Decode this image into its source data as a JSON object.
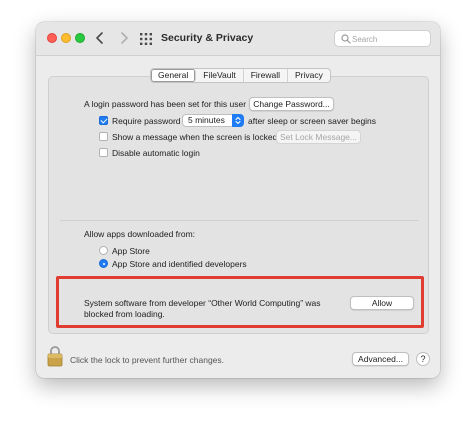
{
  "titlebar": {
    "title": "Security & Privacy",
    "search_placeholder": "Search",
    "icons": [
      "back-chevron-icon",
      "forward-chevron-icon",
      "show-all-grid-icon",
      "search-icon"
    ]
  },
  "tabs": [
    {
      "label": "General",
      "active": true
    },
    {
      "label": "FileVault",
      "active": false
    },
    {
      "label": "Firewall",
      "active": false
    },
    {
      "label": "Privacy",
      "active": false
    }
  ],
  "general": {
    "login_password_text": "A login password has been set for this user",
    "change_password_button": "Change Password...",
    "require_password": {
      "label": "Require password",
      "checked": true,
      "select_value": "5 minutes",
      "suffix": "after sleep or screen saver begins"
    },
    "show_message": {
      "label": "Show a message when the screen is locked",
      "checked": false,
      "button": "Set Lock Message..."
    },
    "disable_auto_login": {
      "label": "Disable automatic login",
      "checked": false
    }
  },
  "allow_apps": {
    "heading": "Allow apps downloaded from:",
    "options": [
      {
        "label": "App Store",
        "selected": false
      },
      {
        "label": "App Store and identified developers",
        "selected": true
      }
    ]
  },
  "blocked": {
    "line1": "System software from developer “Other World Computing” was",
    "line2": "blocked from loading.",
    "allow_button": "Allow"
  },
  "footer": {
    "lock_text": "Click the lock to prevent further changes.",
    "advanced_button": "Advanced...",
    "help_button": "?"
  },
  "colors": {
    "accent": "#1f7cf5",
    "highlight_box": "#e03c31",
    "traffic_close": "#ff5f57",
    "traffic_minimize": "#febc2e",
    "traffic_zoom": "#28c840"
  }
}
